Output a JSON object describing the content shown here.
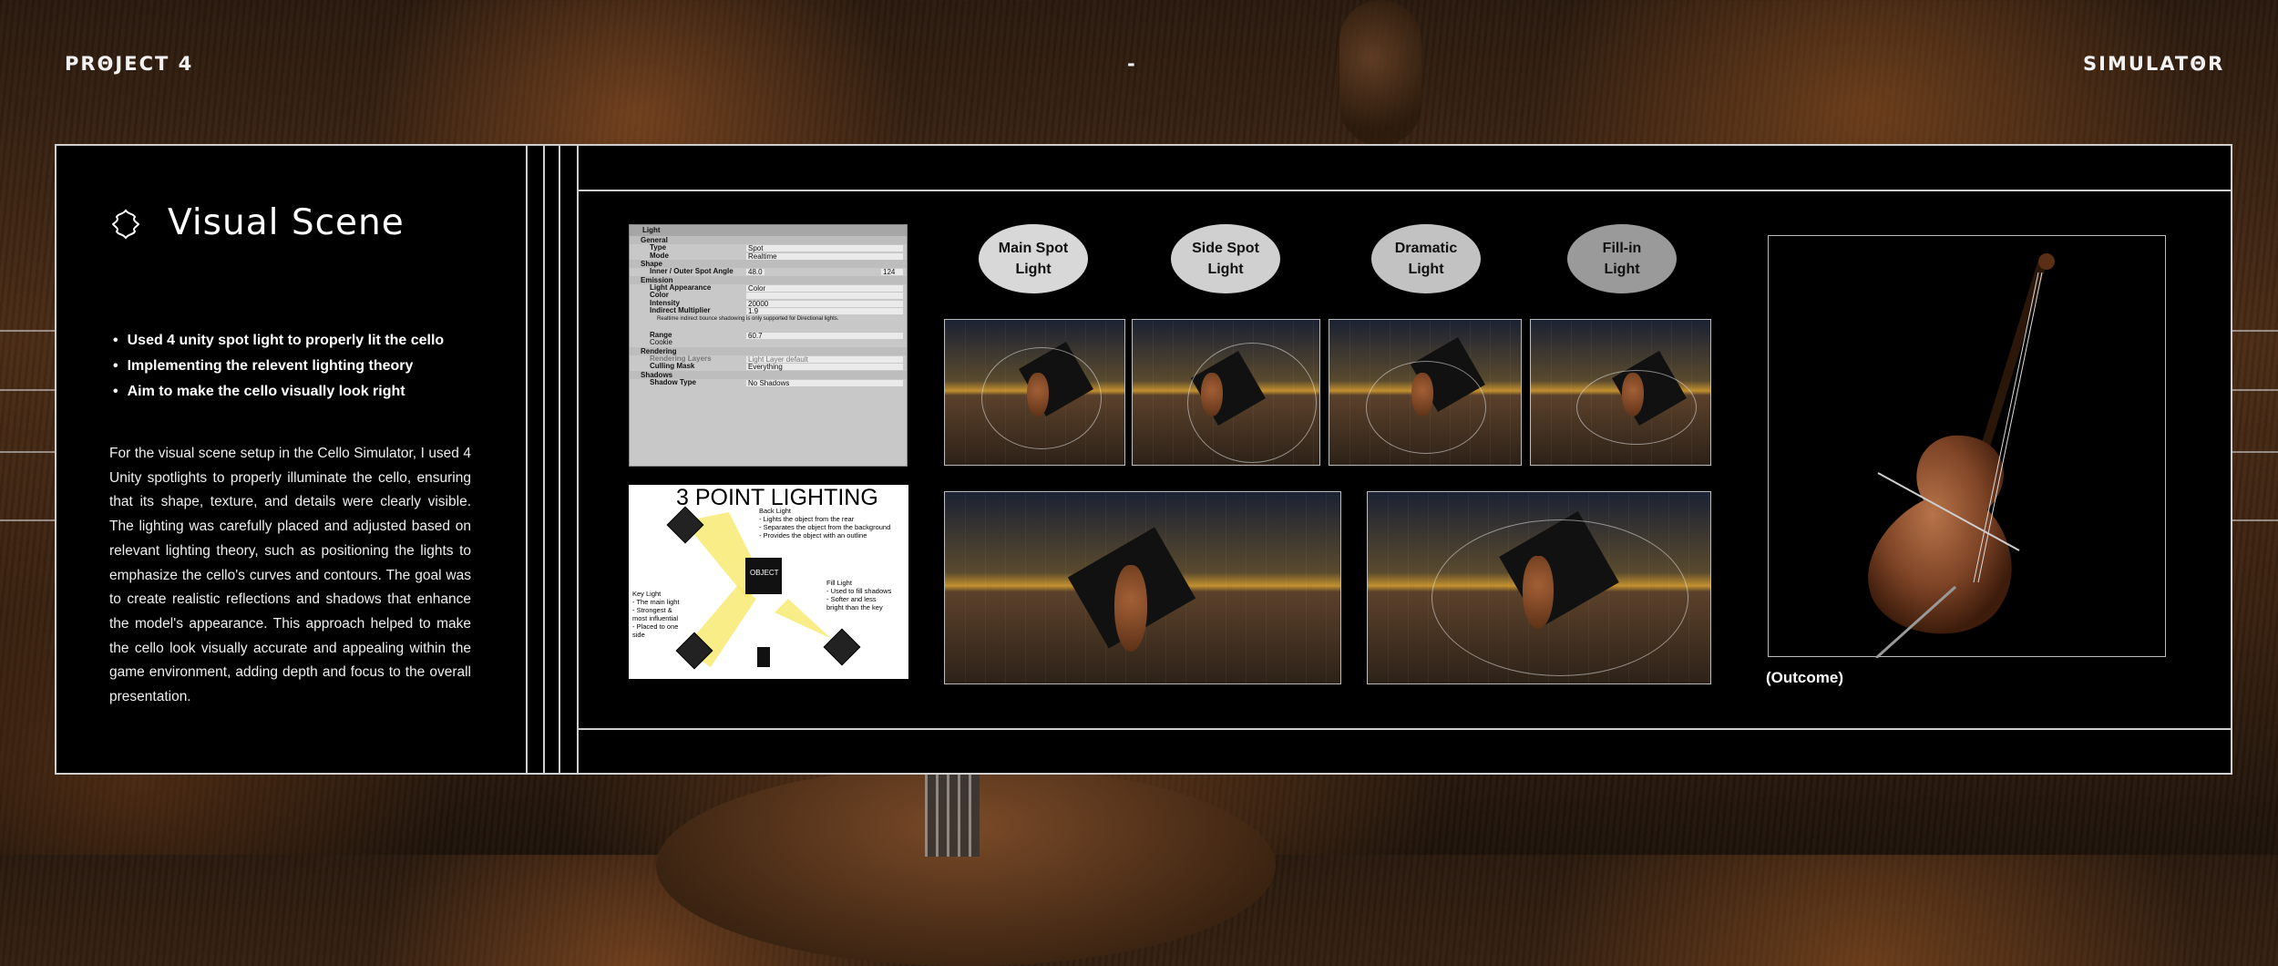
{
  "header": {
    "left": "PRΘJECT 4",
    "center": "-",
    "right": "SIMULATΘR"
  },
  "section": {
    "title": "Visual Scene"
  },
  "bullets": [
    "Used 4 unity spot light to properly lit the cello",
    "Implementing the relevent lighting theory",
    "Aim to make the cello visually look right"
  ],
  "description": "For the visual scene setup in the Cello Simulator, I used 4 Unity spotlights to properly illuminate the cello, ensuring that its shape, texture, and details were clearly visible. The lighting was carefully placed and adjusted based on relevant lighting theory, such as positioning the lights to emphasize the cello's curves and contours. The goal was to create realistic reflections and shadows that enhance the model's appearance. This approach helped to make the cello look visually accurate and appealing within the game environment, adding depth and focus to the overall presentation.",
  "inspector": {
    "title": "Light",
    "general": "General",
    "type_label": "Type",
    "type_value": "Spot",
    "mode_label": "Mode",
    "mode_value": "Realtime",
    "shape": "Shape",
    "angle_label": "Inner / Outer Spot Angle",
    "angle_inner": "48.0",
    "angle_outer": "124",
    "emission": "Emission",
    "appearance_label": "Light Appearance",
    "appearance_value": "Color",
    "color_label": "Color",
    "intensity_label": "Intensity",
    "intensity_value": "20000",
    "indirect_label": "Indirect Multiplier",
    "indirect_value": "1.9",
    "warning": "Realtime indirect bounce shadowing is only supported for Directional lights.",
    "range_label": "Range",
    "range_value": "60.7",
    "cookie": "Cookie",
    "rendering": "Rendering",
    "layers_label": "Rendering Layers",
    "layers_value": "Light Layer default",
    "culling_label": "Culling Mask",
    "culling_value": "Everything",
    "shadows": "Shadows",
    "shadow_type_label": "Shadow Type",
    "shadow_type_value": "No Shadows"
  },
  "diagram": {
    "title": "3 POINT LIGHTING",
    "object": "OBJECT",
    "back_light": "Back Light\n- Lights the object from the rear\n- Separates the object from the background\n- Provides the object with an outline",
    "key_light": "Key Light\n- The main light\n- Strongest &\nmost influential\n- Placed to one\nside",
    "fill_light": "Fill Light\n- Used to fill shadows\n- Softer and less\nbright than the key"
  },
  "light_labels": [
    "Main Spot\nLight",
    "Side Spot\nLight",
    "Dramatic\nLight",
    "Fill-in\nLight"
  ],
  "colors": {
    "pill1": "#d8d8d8",
    "pill2": "#d0d0d0",
    "pill3": "#c2c2c2",
    "pill4": "#9a9a9a",
    "beam": "#f7e96a"
  },
  "outcome_caption": "(Outcome)"
}
